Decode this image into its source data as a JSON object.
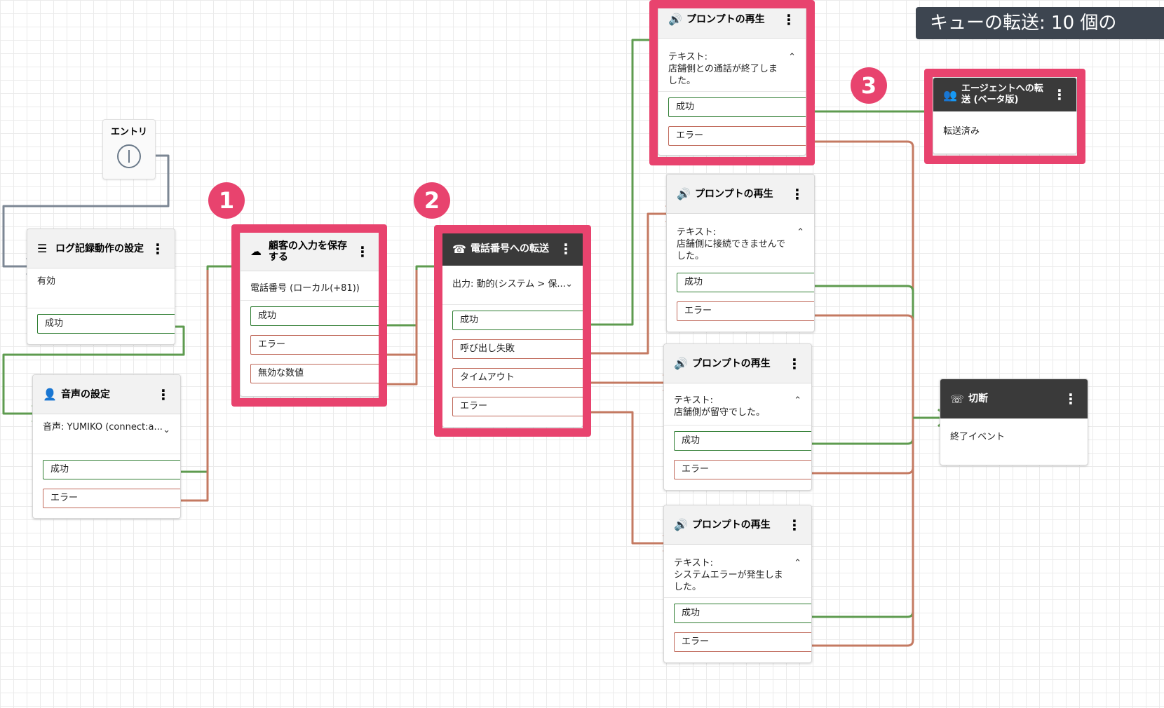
{
  "banner": "キューの転送: 10 個の",
  "entry": {
    "label": "エントリ"
  },
  "badges": [
    "1",
    "2",
    "3"
  ],
  "blocks": {
    "logging": {
      "title": "ログ記録動作の設定",
      "body": "有効",
      "out_success": "成功"
    },
    "voice": {
      "title": "音声の設定",
      "body": "音声: YUMIKO (connect:a...",
      "out_success": "成功",
      "out_error": "エラー"
    },
    "store_input": {
      "title": "顧客の入力を保存する",
      "body": "電話番号 (ローカル(+81))",
      "out_success": "成功",
      "out_error": "エラー",
      "out_invalid": "無効な数値"
    },
    "transfer_phone": {
      "title": "電話番号への転送",
      "body": "出力: 動的(システム > 保...",
      "out_success": "成功",
      "out_call_failed": "呼び出し失敗",
      "out_timeout": "タイムアウト",
      "out_error": "エラー"
    },
    "prompt1": {
      "title": "プロンプトの再生",
      "body_label": "テキスト:",
      "body": "店舗側との通話が終了しました。",
      "out_success": "成功",
      "out_error": "エラー"
    },
    "prompt2": {
      "title": "プロンプトの再生",
      "body_label": "テキスト:",
      "body": "店舗側に接続できませんでした。",
      "out_success": "成功",
      "out_error": "エラー"
    },
    "prompt3": {
      "title": "プロンプトの再生",
      "body_label": "テキスト:",
      "body": "店舗側が留守でした。",
      "out_success": "成功",
      "out_error": "エラー"
    },
    "prompt4": {
      "title": "プロンプトの再生",
      "body_label": "テキスト:",
      "body": "システムエラーが発生しました。",
      "out_success": "成功",
      "out_error": "エラー"
    },
    "transfer_agent": {
      "title": "エージェントへの転送 (ベータ版)",
      "body": "転送済み"
    },
    "disconnect": {
      "title": "切断",
      "body": "終了イベント"
    }
  },
  "colors": {
    "highlight": "#e8436e",
    "success_wire": "#5e9b4f",
    "error_wire": "#c47a62",
    "entry_wire": "#7c8794"
  }
}
